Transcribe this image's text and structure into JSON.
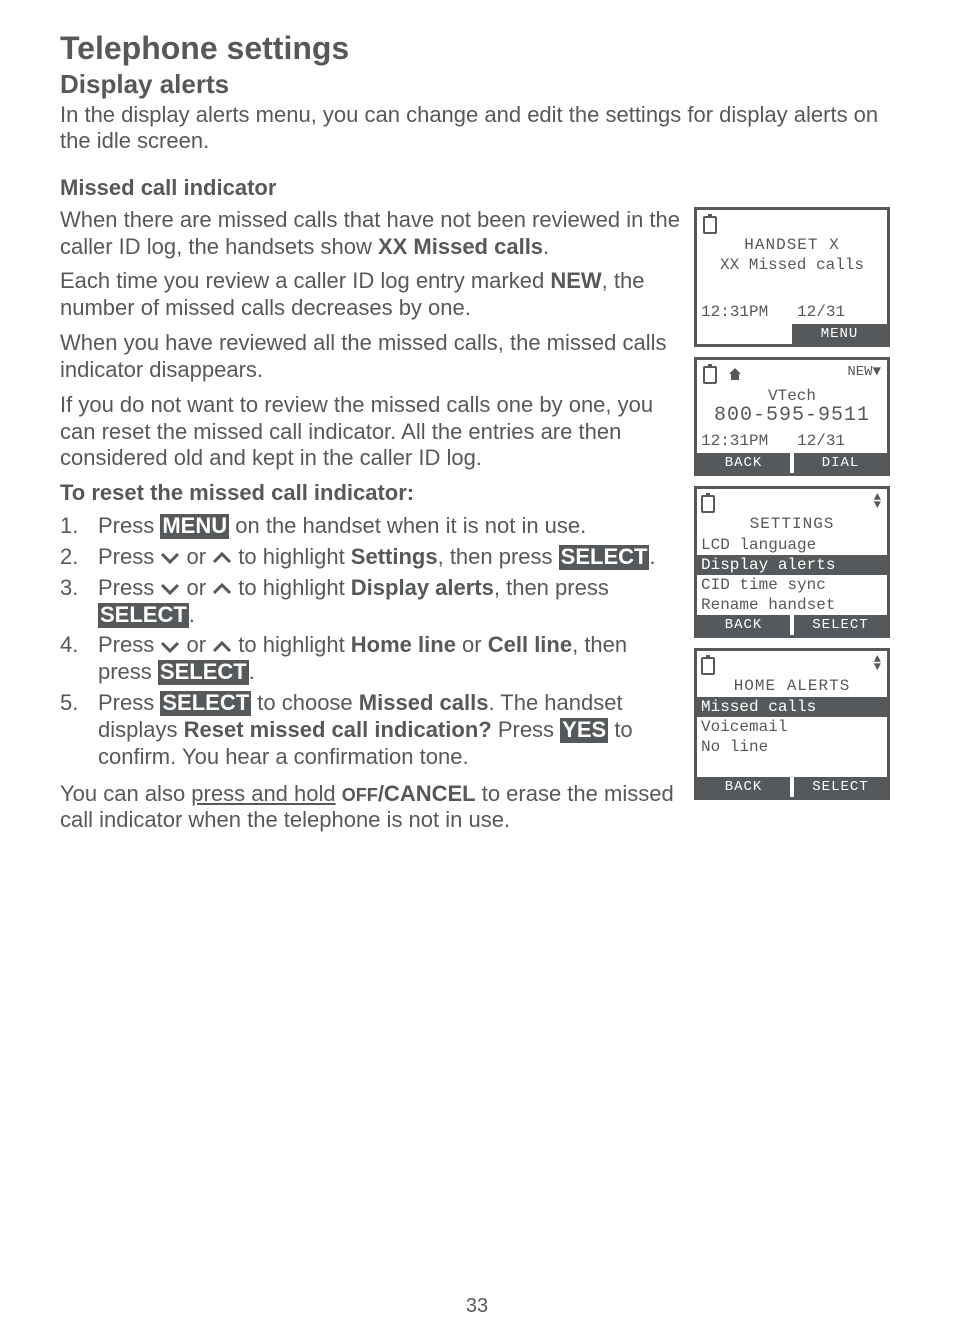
{
  "page_title": "Telephone settings",
  "section_title": "Display alerts",
  "intro": "In the display alerts menu, you can change and edit the settings for display alerts on the idle screen.",
  "sub1_title": "Missed call indicator",
  "p1a": "When there are missed calls that have not been reviewed in the caller ID log, the handsets show ",
  "p1b": "XX Missed calls",
  "p1c": ".",
  "p2a": "Each time you review a caller ID log entry marked ",
  "p2b": "NEW",
  "p2c": ", the number of missed calls decreases by one.",
  "p3": "When you have reviewed all the missed calls, the missed calls indicator disappears.",
  "p4": "If you do not want to review the missed calls one by one, you can reset the missed call indicator. All the entries are then considered old and kept in the caller ID log.",
  "sub2_title": "To reset the missed call indicator:",
  "steps": {
    "s1a": "Press ",
    "s1b": "MENU",
    "s1c": " on the handset when it is not in use.",
    "s2a": "Press ",
    "s2b": " or ",
    "s2c": " to highlight ",
    "s2d": "Settings",
    "s2e": ", then press ",
    "s2f": "SELECT",
    "s2g": ".",
    "s3d": "Display alerts",
    "s4d1": "Home line",
    "s4mid": " or ",
    "s4d2": "Cell line",
    "s5a": "Press ",
    "s5b": "SELECT",
    "s5c": " to choose ",
    "s5d": "Missed calls",
    "s5e": ". The handset displays ",
    "s5f": "Reset missed call indication?",
    "s5g": " Press ",
    "s5h": "YES",
    "s5i": " to confirm. You hear a confirmation tone."
  },
  "p5a": "You can also ",
  "p5b": "press and hold",
  "p5c": " ",
  "p5d": "OFF",
  "p5e": "/CANCEL",
  "p5f": " to erase the missed call indicator when the telephone is not in use.",
  "lcd1": {
    "title": "HANDSET   X",
    "sub": "XX Missed calls",
    "time": "12:31PM   12/31",
    "btn": "MENU"
  },
  "lcd2": {
    "new": "NEW",
    "name": "VTech",
    "num": "800-595-9511",
    "time": "12:31PM   12/31",
    "back": "BACK",
    "dial": "DIAL"
  },
  "lcd3": {
    "title": "SETTINGS",
    "i1": "LCD language",
    "i2": "Display alerts",
    "i3": "CID time sync",
    "i4": "Rename handset",
    "back": "BACK",
    "sel": "SELECT"
  },
  "lcd4": {
    "title": "HOME ALERTS",
    "i1": "Missed calls",
    "i2": "Voicemail",
    "i3": "No line",
    "back": "BACK",
    "sel": "SELECT"
  },
  "page_number": "33"
}
